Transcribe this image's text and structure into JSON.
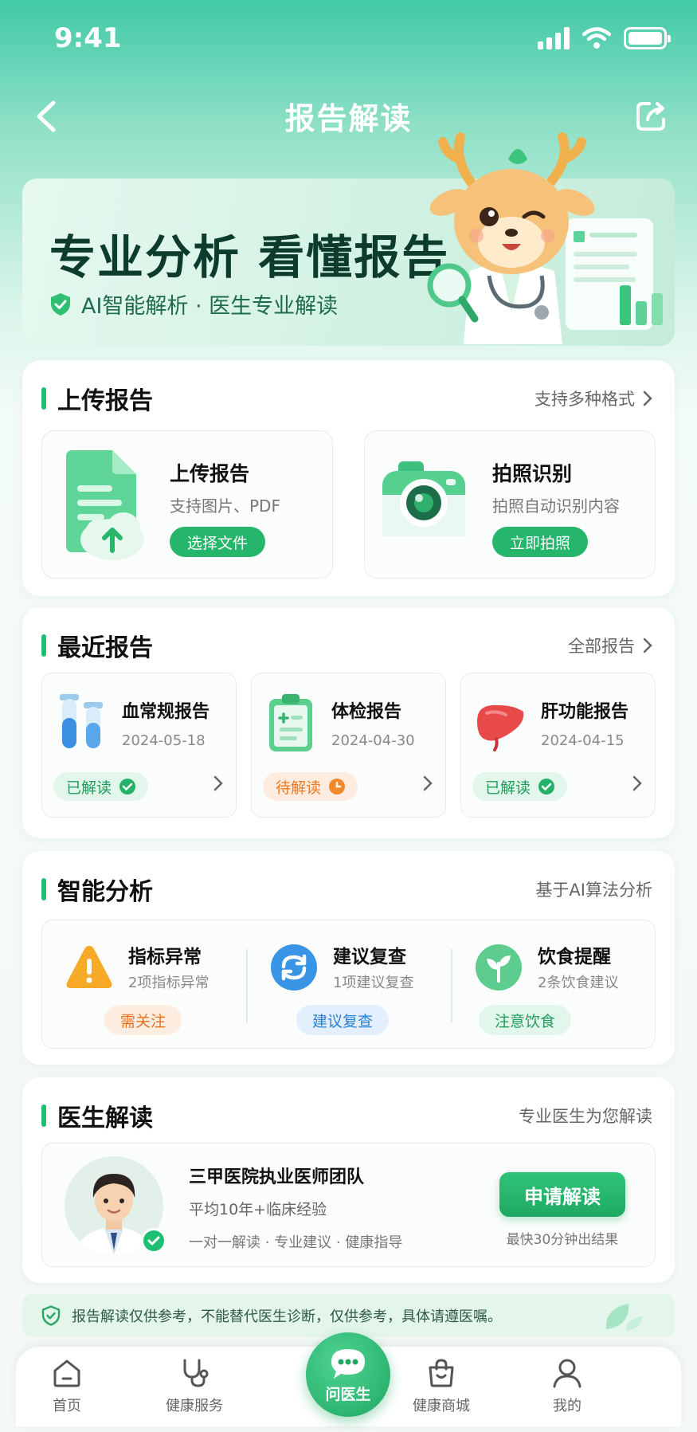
{
  "status_bar": {
    "time": "9:41"
  },
  "nav": {
    "title": "报告解读"
  },
  "banner": {
    "title": "专业分析  看懂报告",
    "subtitle": "AI智能解析 · 医生专业解读"
  },
  "upload": {
    "title": "上传报告",
    "link": "支持多种格式",
    "options": [
      {
        "title": "上传报告",
        "subtitle": "支持图片、PDF",
        "button": "选择文件",
        "icon": "file-upload-icon"
      },
      {
        "title": "拍照识别",
        "subtitle": "拍照自动识别内容",
        "button": "立即拍照",
        "icon": "camera-icon"
      }
    ]
  },
  "recent": {
    "title": "最近报告",
    "link": "全部报告",
    "items": [
      {
        "name": "血常规报告",
        "date": "2024-05-18",
        "status": "已解读",
        "icon": "test-tubes-icon"
      },
      {
        "name": "体检报告",
        "date": "2024-04-30",
        "status": "待解读",
        "icon": "clipboard-icon"
      },
      {
        "name": "肝功能报告",
        "date": "2024-04-15",
        "status": "已解读",
        "icon": "liver-icon"
      }
    ]
  },
  "analysis": {
    "title": "智能分析",
    "link": "基于AI算法分析",
    "items": [
      {
        "title": "指标异常",
        "subtitle": "2项指标异常",
        "tag": "需关注",
        "icon": "warning-icon"
      },
      {
        "title": "建议复查",
        "subtitle": "1项建议复查",
        "tag": "建议复查",
        "icon": "refresh-icon"
      },
      {
        "title": "饮食提醒",
        "subtitle": "2条饮食建议",
        "tag": "注意饮食",
        "icon": "leaf-icon"
      }
    ]
  },
  "doctor": {
    "title": "医生解读",
    "link": "专业医生为您解读",
    "team": "三甲医院执业医师团队",
    "experience": "平均10年+临床经验",
    "tags": "一对一解读 · 专业建议 · 健康指导",
    "button": "申请解读",
    "note": "最快30分钟出结果"
  },
  "disclaimer": "报告解读仅供参考，不能替代医生诊断，仅供参考，具体请遵医嘱。",
  "tabs": [
    {
      "label": "首页",
      "icon": "home-icon"
    },
    {
      "label": "健康服务",
      "icon": "stethoscope-icon"
    },
    {
      "label": "问医生",
      "icon": "chat-icon"
    },
    {
      "label": "健康商城",
      "icon": "shopping-bag-icon"
    },
    {
      "label": "我的",
      "icon": "user-icon"
    }
  ],
  "colors": {
    "primary": "#1fbf73",
    "warning": "#ef7a21",
    "info": "#2a86e0"
  }
}
